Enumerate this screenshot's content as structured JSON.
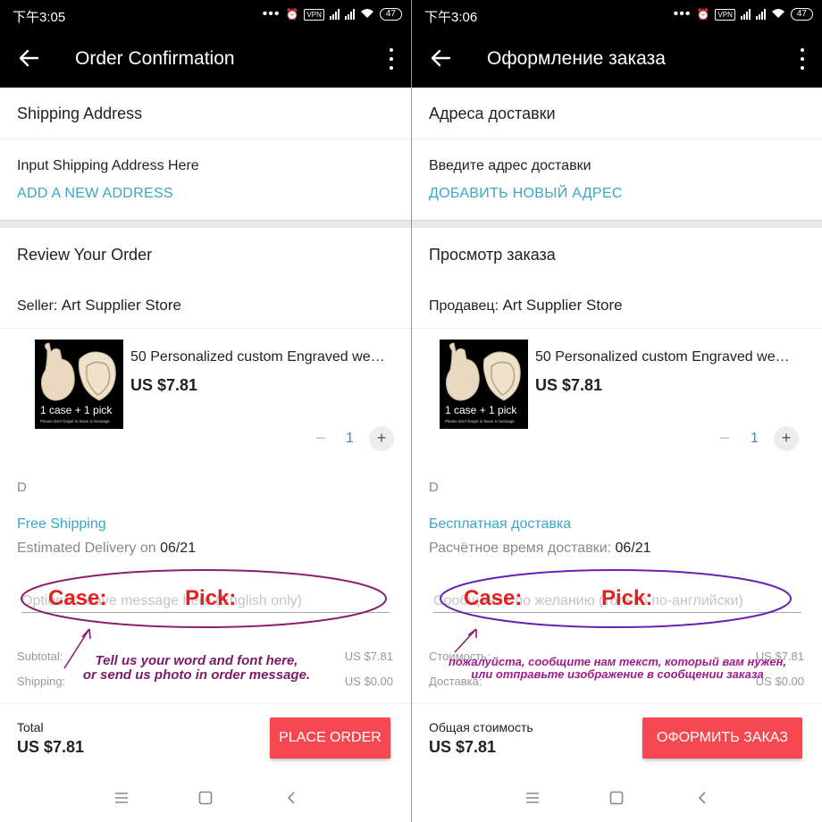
{
  "status": {
    "time_left": "下午3:05",
    "time_right": "下午3:06",
    "vpn": "VPN",
    "battery": "47"
  },
  "left": {
    "title": "Order Confirmation",
    "shipping_address": "Shipping Address",
    "input_address": "Input Shipping Address Here",
    "add_address": "ADD A NEW ADDRESS",
    "review": "Review Your Order",
    "seller_label": "Seller: ",
    "seller_name": "Art Supplier Store",
    "product_name": "50 Personalized custom Engraved wedding guitar pick case",
    "product_price": "US $7.81",
    "qty": "1",
    "sku": "D",
    "free_shipping": "Free Shipping",
    "est_label": "Estimated Delivery on ",
    "est_date": "06/21",
    "message_placeholder": "Optional: leave message here (English only)",
    "subtotal_label": "Subtotal:",
    "subtotal_val": "US $7.81",
    "shipping_label": "Shipping:",
    "shipping_val": "US $0.00",
    "total_label": "Total",
    "total_val": "US $7.81",
    "place_order": "PLACE ORDER",
    "annot_case": "Case:",
    "annot_pick": "Pick:",
    "annot_line1": "Tell us your word and font here,",
    "annot_line2": "or send us photo in order message."
  },
  "right": {
    "title": "Оформление заказа",
    "shipping_address": "Адреса доставки",
    "input_address": "Введите адрес доставки",
    "add_address": "ДОБАВИТЬ НОВЫЙ АДРЕС",
    "review": "Просмотр заказа",
    "seller_label": "Продавец: ",
    "seller_name": "Art Supplier Store",
    "product_name": "50 Personalized custom Engraved wedding guitar pick case",
    "product_price": "US $7.81",
    "qty": "1",
    "sku": "D",
    "free_shipping": "Бесплатная доставка",
    "est_label": "Расчётное время доставки: ",
    "est_date": "06/21",
    "message_placeholder": "Сообщение по желанию (только по-английски)",
    "subtotal_label": "Стоимость:",
    "subtotal_val": "US $7.81",
    "shipping_label": "Доставка:",
    "shipping_val": "US $0.00",
    "total_label": "Общая стоимость",
    "total_val": "US $7.81",
    "place_order": "ОФОРМИТЬ ЗАКАЗ",
    "annot_case": "Case:",
    "annot_pick": "Pick:",
    "annot_line1": "пожалуйста, сообщите нам текст, который вам нужен,",
    "annot_line2": "или отправьте изображение в сообщении заказа"
  },
  "thumb": {
    "caption": "1 case + 1 pick",
    "small": "Please don't forget to leave a message."
  },
  "icons": {
    "back": "back-arrow-icon",
    "more": "more-vertical-icon",
    "menu": "menu-icon",
    "home": "home-icon",
    "nav_back": "nav-back-icon"
  },
  "colors": {
    "link": "#3aa6c7",
    "button": "#f64850",
    "annotation": "#7a1a6a",
    "annotation_label": "#e32020"
  }
}
